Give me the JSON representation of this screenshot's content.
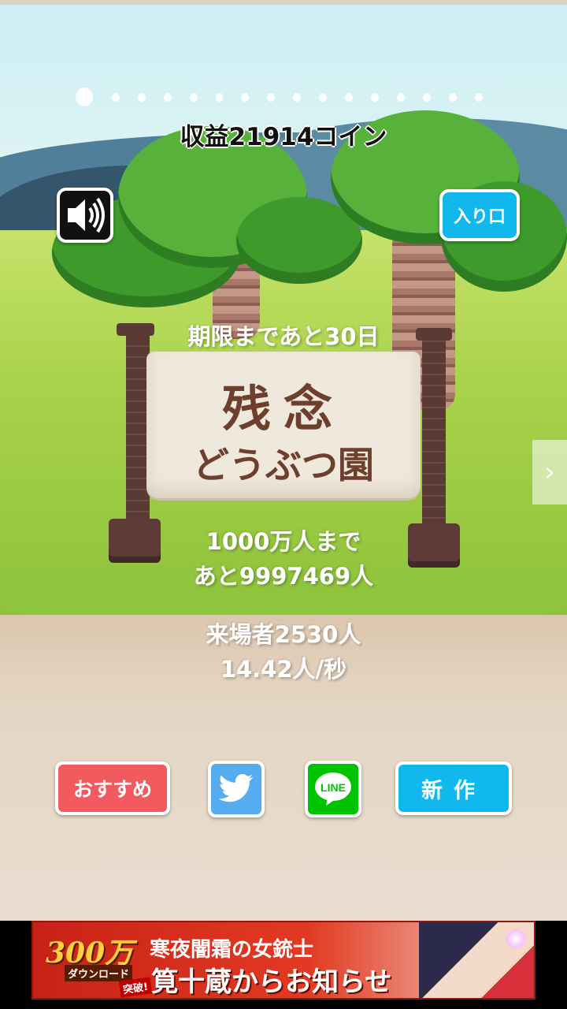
{
  "profit_text": "収益21914コイン",
  "deadline_text": "期限まであと30日",
  "entrance_label": "入り口",
  "sign": {
    "line1": "残念",
    "line2": "どうぶつ園"
  },
  "goal": {
    "line1": "1000万人まで",
    "line2": "あと9997469人"
  },
  "visitors": {
    "line1": "来場者2530人",
    "line2": "14.42人/秒"
  },
  "buttons": {
    "recommend": "おすすめ",
    "line": "LINE",
    "new_work": "新作"
  },
  "pager": {
    "count": 16,
    "active_index": 0
  },
  "ad": {
    "badge_num": "300万",
    "badge_sub": "ダウンロード",
    "badge_sub2": "突破!",
    "line1": "寒夜闇霜の女銃士",
    "line2": "筧十蔵からお知らせ"
  },
  "colors": {
    "entrance": "#10b8ee",
    "recommend": "#f25a5f",
    "twitter": "#55acee",
    "line": "#00c300",
    "new_work": "#10b8ee"
  },
  "icons": {
    "sound": "speaker-icon",
    "twitter": "twitter-bird-icon",
    "line": "line-bubble-icon",
    "next": "chevron-right-icon"
  }
}
